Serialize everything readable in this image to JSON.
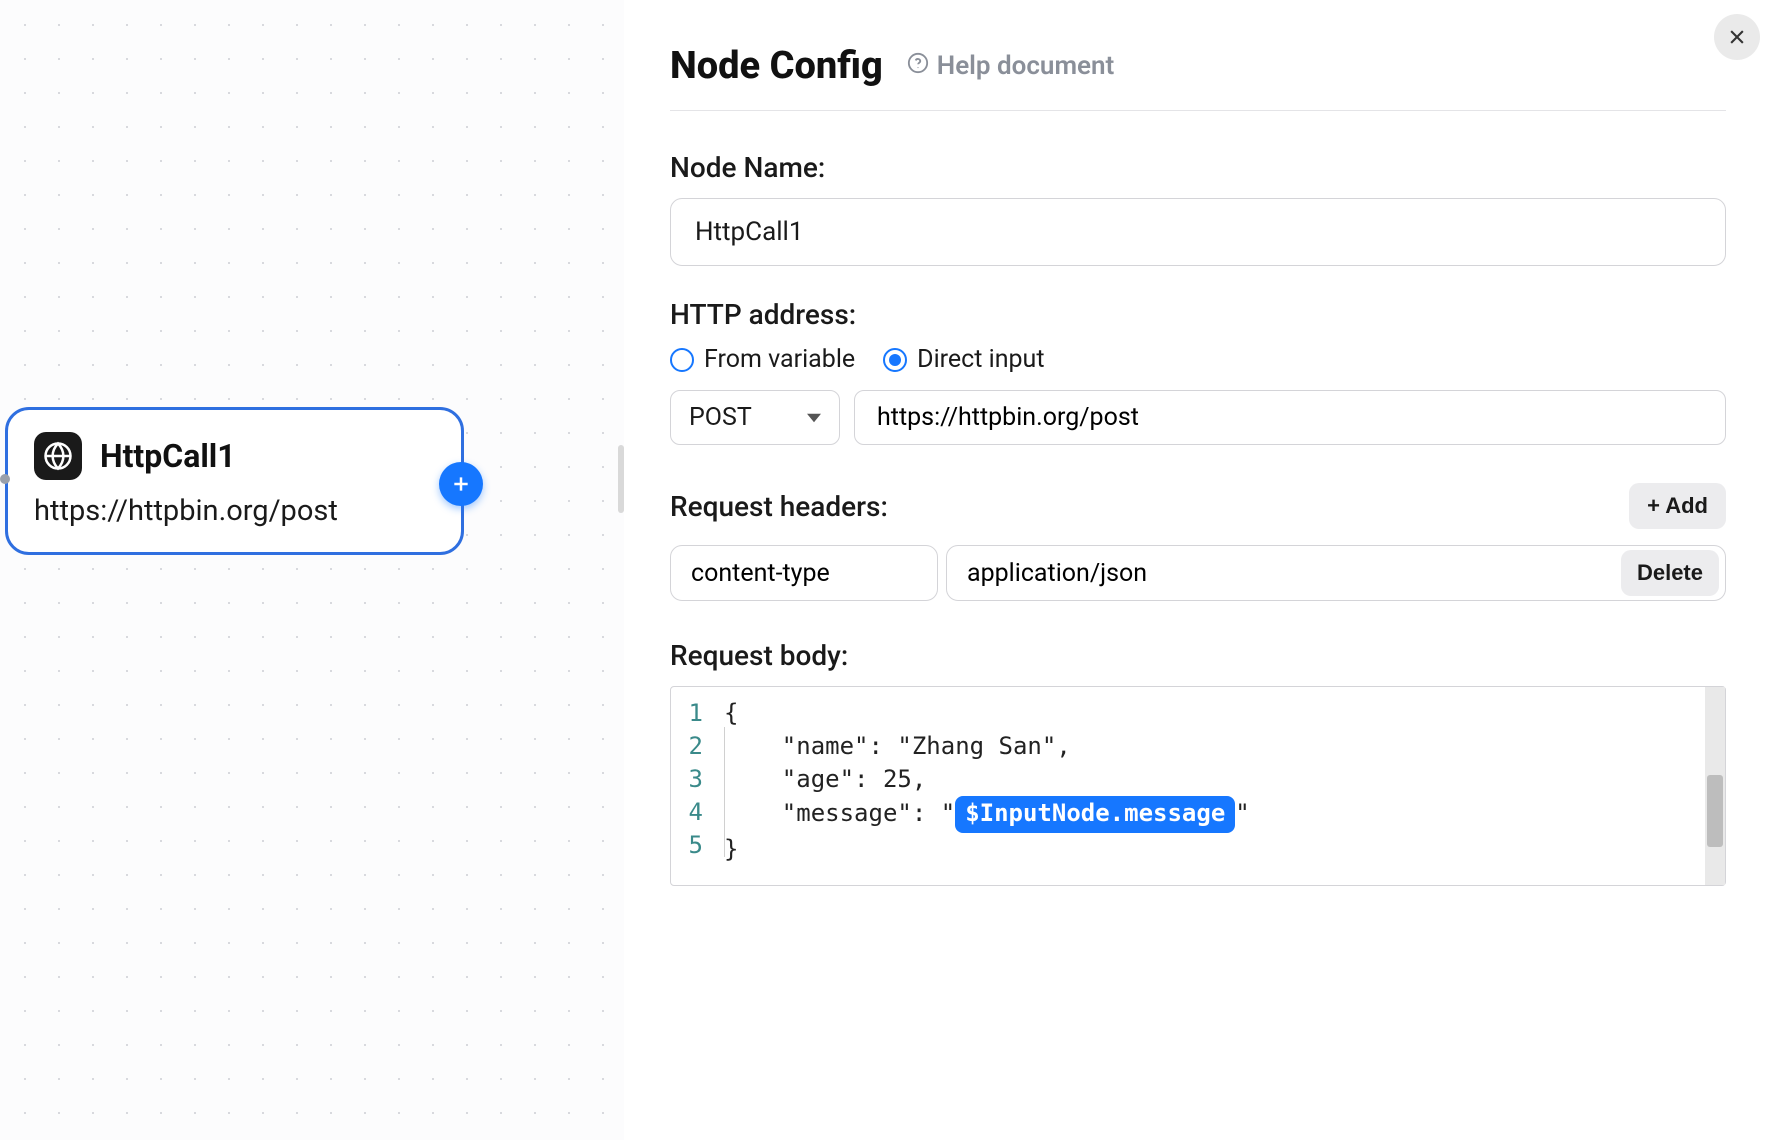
{
  "canvas": {
    "node": {
      "title": "HttpCall1",
      "subtitle": "https://httpbin.org/post"
    }
  },
  "panel": {
    "title": "Node Config",
    "help_label": "Help document",
    "node_name": {
      "label": "Node Name:",
      "value": "HttpCall1"
    },
    "http_address": {
      "label": "HTTP address:",
      "option_variable": "From variable",
      "option_direct": "Direct input",
      "selected": "direct",
      "method": "POST",
      "url": "https://httpbin.org/post"
    },
    "headers": {
      "label": "Request headers:",
      "add_label": "+ Add",
      "rows": [
        {
          "key": "content-type",
          "value": "application/json",
          "delete_label": "Delete"
        }
      ]
    },
    "body": {
      "label": "Request body:",
      "lines": [
        "1",
        "2",
        "3",
        "4",
        "5"
      ],
      "code_l1": "{",
      "code_l2_pre": "    \"name\": \"Zhang San\",",
      "code_l3_pre": "    \"age\": 25,",
      "code_l4_pre": "    \"message\": \"",
      "code_l4_var": "$InputNode.message",
      "code_l4_post": "\"",
      "code_l5": "}"
    }
  }
}
